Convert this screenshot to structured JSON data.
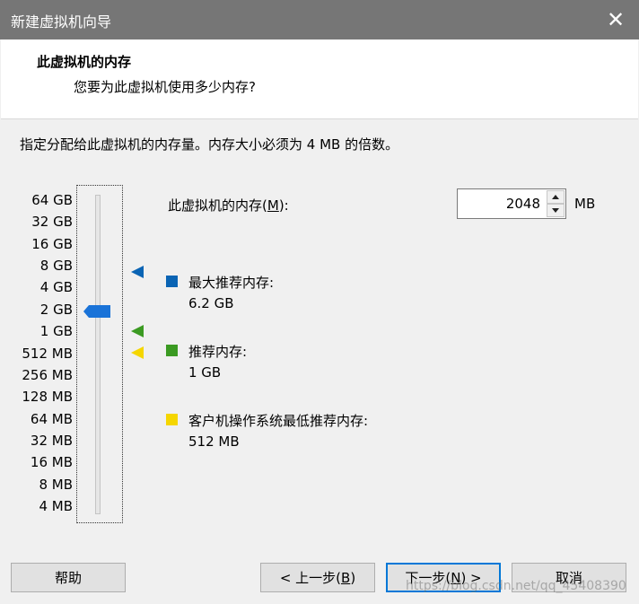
{
  "window": {
    "title": "新建虚拟机向导"
  },
  "header": {
    "title": "此虚拟机的内存",
    "subtitle": "您要为此虚拟机使用多少内存?"
  },
  "instruction": "指定分配给此虚拟机的内存量。内存大小必须为 4 MB 的倍数。",
  "slider": {
    "ticks": [
      "64 GB",
      "32 GB",
      "16 GB",
      "8 GB",
      "4 GB",
      "2 GB",
      "1 GB",
      "512 MB",
      "256 MB",
      "128 MB",
      "64 MB",
      "32 MB",
      "16 MB",
      "8 MB",
      "4 MB"
    ],
    "selected": "2 GB"
  },
  "memory": {
    "label_pre": "此虚拟机的内存(",
    "label_key": "M",
    "label_post": "):",
    "value": "2048",
    "unit": "MB"
  },
  "legend": {
    "max": {
      "label": "最大推荐内存:",
      "value": "6.2 GB",
      "color": "#0a64b4"
    },
    "recommended": {
      "label": "推荐内存:",
      "value": "1 GB",
      "color": "#3b9a22"
    },
    "guest_min": {
      "label": "客户机操作系统最低推荐内存:",
      "value": "512 MB",
      "color": "#f5d600"
    }
  },
  "buttons": {
    "help": "帮助",
    "back_pre": "< 上一步(",
    "back_key": "B",
    "back_post": ")",
    "next_pre": "下一步(",
    "next_key": "N",
    "next_post": ") >",
    "cancel": "取消"
  },
  "icons": {
    "close": "close-icon",
    "spin_up": "chevron-up-icon",
    "spin_down": "chevron-down-icon"
  },
  "watermark": "https://blog.csdn.net/qq_45408390"
}
